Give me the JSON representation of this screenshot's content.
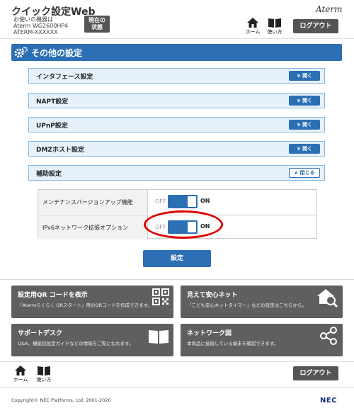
{
  "header": {
    "app_title": "クイック設定Web",
    "device_info": [
      "お使いの機器は",
      "Aterm WG2600HP4",
      "ATERM-XXXXXX"
    ],
    "status_button": "現在の\n状態",
    "brand": "Aterm",
    "home_label": "ホーム",
    "manual_label": "使い方",
    "logout_label": "ログアウト"
  },
  "section": {
    "title": "その他の設定",
    "accordions": [
      {
        "label": "インタフェース設定",
        "button": "開く",
        "expanded": false
      },
      {
        "label": "NAPT設定",
        "button": "開く",
        "expanded": false
      },
      {
        "label": "UPnP設定",
        "button": "開く",
        "expanded": false
      },
      {
        "label": "DMZホスト設定",
        "button": "開く",
        "expanded": false
      },
      {
        "label": "補助設定",
        "button": "閉じる",
        "expanded": true
      }
    ],
    "options": [
      {
        "label": "メンテナンスバージョンアップ機能",
        "off": "OFF",
        "on": "ON",
        "value": "ON"
      },
      {
        "label": "IPv6ネットワーク拡張オプション",
        "off": "OFF",
        "on": "ON",
        "value": "ON"
      }
    ],
    "apply_label": "設定"
  },
  "cards": [
    {
      "title": "設定用QR コードを表示",
      "desc": "「Atermらくらく QRスタート」用のQRコードを作成できます。",
      "icon": "qr-code-icon"
    },
    {
      "title": "見えて安心ネット",
      "desc": "「こども安心ネットタイマー」などの設定はこちらから。",
      "icon": "home-search-icon"
    },
    {
      "title": "サポートデスク",
      "desc": "Q&A、機能別設定ガイドなどの情報をご覧になれます。",
      "icon": "book-icon"
    },
    {
      "title": "ネットワーク図",
      "desc": "本商品に接続している端末を確認できます。",
      "icon": "network-icon"
    }
  ],
  "footer": {
    "home_label": "ホーム",
    "manual_label": "使い方",
    "logout_label": "ログアウト",
    "copyright": "Copyright© NEC Platforms, Ltd. 2001-2020",
    "logo": "NEC"
  },
  "colors": {
    "accent": "#2c6fb5",
    "card_bg": "#5f5f5f",
    "highlight": "#e00000"
  }
}
